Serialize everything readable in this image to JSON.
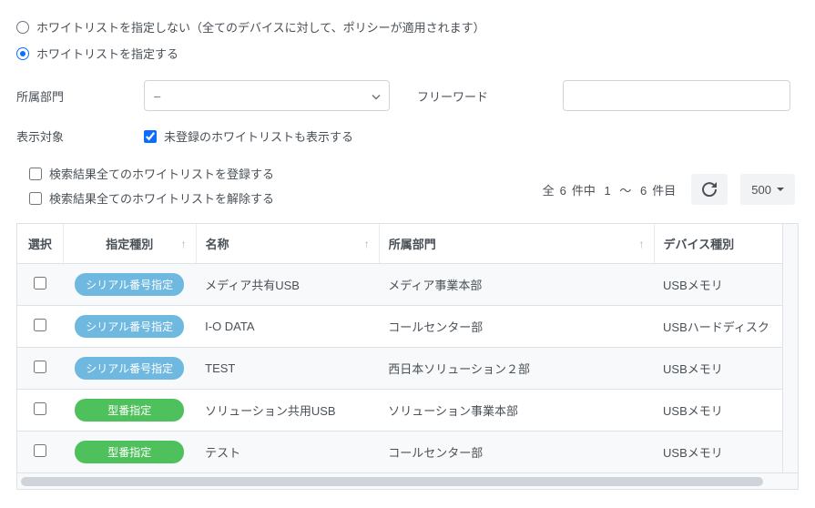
{
  "radios": {
    "noWhitelist": "ホワイトリストを指定しない（全てのデバイスに対して、ポリシーが適用されます）",
    "specify": "ホワイトリストを指定する"
  },
  "filters": {
    "deptLabel": "所属部門",
    "deptSelected": "–",
    "freewordLabel": "フリーワード",
    "freewordValue": "",
    "displayTargetLabel": "表示対象",
    "displayCheckboxLabel": "未登録のホワイトリストも表示する"
  },
  "bulk": {
    "registerAll": "検索結果全てのホワイトリストを登録する",
    "removeAll": "検索結果全てのホワイトリストを解除する"
  },
  "pager": {
    "prefix": "全",
    "total": "6",
    "midfix": "件中",
    "from": "1",
    "tilde": "～",
    "to": "6",
    "suffix": "件目",
    "pageSize": "500"
  },
  "columns": {
    "select": "選択",
    "type": "指定種別",
    "name": "名称",
    "dept": "所属部門",
    "device": "デバイス種別"
  },
  "badges": {
    "serial": "シリアル番号指定",
    "model": "型番指定"
  },
  "rows": [
    {
      "type": "serial",
      "name": "メディア共有USB",
      "dept": "メディア事業本部",
      "device": "USBメモリ"
    },
    {
      "type": "serial",
      "name": "I-O DATA",
      "dept": "コールセンター部",
      "device": "USBハードディスク"
    },
    {
      "type": "serial",
      "name": "TEST",
      "dept": "西日本ソリューション２部",
      "device": "USBメモリ"
    },
    {
      "type": "model",
      "name": "ソリューション共用USB",
      "dept": "ソリューション事業本部",
      "device": "USBメモリ"
    },
    {
      "type": "model",
      "name": "テスト",
      "dept": "コールセンター部",
      "device": "USBメモリ"
    }
  ]
}
